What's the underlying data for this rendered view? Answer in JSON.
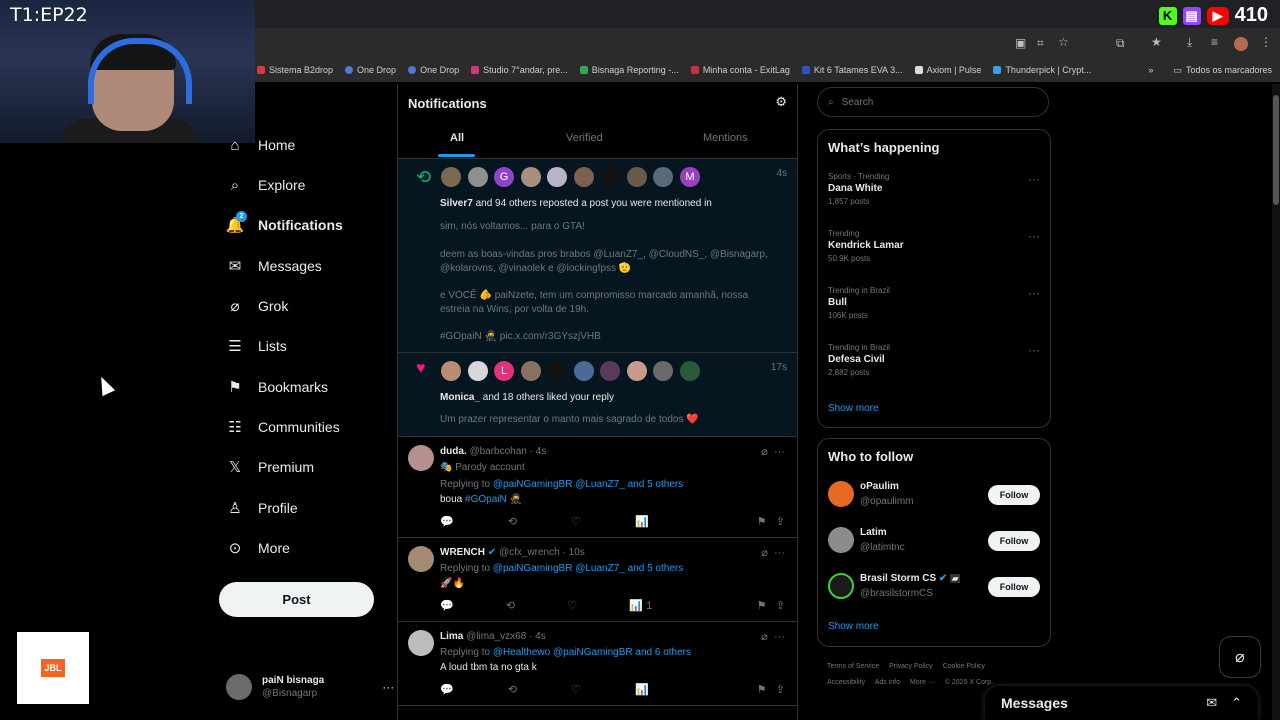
{
  "stream": {
    "label": "T1:EP22",
    "viewers": "410"
  },
  "bookmarks": [
    "Sistema B2drop",
    "One Drop",
    "One Drop",
    "Studio 7°andar, pre...",
    "Bisnaga Reporting -...",
    "Minha conta - ExitLag",
    "Kit 6 Tatames EVA 3...",
    "Axiom | Pulse",
    "Thunderpick | Crypt...",
    "Todos os marcadores"
  ],
  "nav": {
    "home": "Home",
    "explore": "Explore",
    "notifications": "Notifications",
    "notif_badge": "2",
    "messages": "Messages",
    "grok": "Grok",
    "lists": "Lists",
    "bookmarks": "Bookmarks",
    "communities": "Communities",
    "premium": "Premium",
    "profile": "Profile",
    "more": "More",
    "post": "Post"
  },
  "account": {
    "name": "paiN bisnaga",
    "handle": "@Bisnagarp"
  },
  "jbl": "JBL",
  "notifications": {
    "title": "Notifications",
    "tabs": [
      "All",
      "Verified",
      "Mentions"
    ],
    "repost": {
      "time": "4s",
      "avatars": [
        "G",
        "M"
      ],
      "headline_user": "Silver7",
      "headline_rest": " and 94 others reposted a post you were mentioned in",
      "line1": "sim, nós voltamos... para o GTA!",
      "line2": "deem as boas-vindas pros brabos @LuanZ7_, @CloudNS_, @Bisnagarp, @kolarovns, @vinaolek e @lockingfpss 🫡",
      "line3": "e VOCÊ 🫵 paiNzete, tem um compromisso marcado amanhã, nossa estreia na Wins, por volta de 19h.",
      "line4": "#GOpaiN 🥷 pic.x.com/r3GYszjVHB"
    },
    "like": {
      "time": "17s",
      "avatar_letter": "L",
      "headline_user": "Monica_",
      "headline_rest": " and 18 others liked your reply",
      "line1": "Um prazer representar o manto mais sagrado de todos ❤️"
    },
    "posts": [
      {
        "name": "duda.",
        "handle": "@barbcohan · 4s",
        "parody": "🎭 Parody account",
        "replying": "Replying to ",
        "mentions": "@paiNGamingBR @LuanZ7_ and 5 others",
        "text": "boua ",
        "tag": "#GOpaiN 🥷",
        "views": ""
      },
      {
        "name": "WRENCH",
        "handle": "@cfx_wrench · 10s",
        "replying": "Replying to ",
        "mentions": "@paiNGamingBR @LuanZ7_ and 5 others",
        "text": "🚀🔥",
        "views": "1"
      },
      {
        "name": "Lima",
        "handle": "@lima_vzx68 · 4s",
        "replying": "Replying to ",
        "mentions": "@Healthewo @paiNGamingBR and 6 others",
        "text": "A loud tbm ta no gta k",
        "views": ""
      }
    ]
  },
  "search": {
    "placeholder": "Search"
  },
  "whats_happening": {
    "title": "What’s happening",
    "trends": [
      {
        "category": "Sports · Trending",
        "name": "Dana White",
        "count": "1,857 posts"
      },
      {
        "category": "Trending",
        "name": "Kendrick Lamar",
        "count": "50.9K posts"
      },
      {
        "category": "Trending in Brazil",
        "name": "Bull",
        "count": "106K posts"
      },
      {
        "category": "Trending in Brazil",
        "name": "Defesa Civil",
        "count": "2,882 posts"
      }
    ],
    "show_more": "Show more"
  },
  "who_to_follow": {
    "title": "Who to follow",
    "people": [
      {
        "name": "oPaulim",
        "handle": "@opaulimm",
        "button": "Follow"
      },
      {
        "name": "Latim",
        "handle": "@latimtnc",
        "button": "Follow"
      },
      {
        "name": "Brasil Storm CS",
        "handle": "@brasilstormCS",
        "button": "Follow"
      }
    ],
    "show_more": "Show more"
  },
  "footer": {
    "links": [
      "Terms of Service",
      "Privacy Policy",
      "Cookie Policy",
      "Accessibility",
      "Ads info",
      "More ···",
      "© 2025 X Corp."
    ]
  },
  "messages_bar": {
    "title": "Messages"
  },
  "colors": {
    "accent": "#1d9bf0",
    "like": "#f91880",
    "repost": "#00ba7c",
    "background": "#000000"
  }
}
